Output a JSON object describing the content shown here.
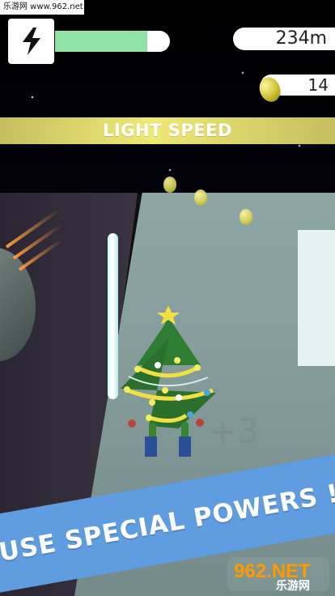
{
  "watermark": {
    "top_text": "乐游网 www.962.net",
    "bottom_main": "962.NET",
    "bottom_sub": "乐游网"
  },
  "hud": {
    "power_icon": "lightning-bolt-icon",
    "energy_level": 0.8,
    "distance": "234m",
    "coins": "14"
  },
  "banners": {
    "speed": "LIGHT SPEED",
    "promo": "USE SPECIAL POWERS !"
  },
  "gameplay": {
    "popup_score": "+3"
  },
  "colors": {
    "energy": "#8fe2a7",
    "speed_banner": "#efe875",
    "promo_banner": "#5f9de0",
    "coin": "#d7cf4c"
  }
}
